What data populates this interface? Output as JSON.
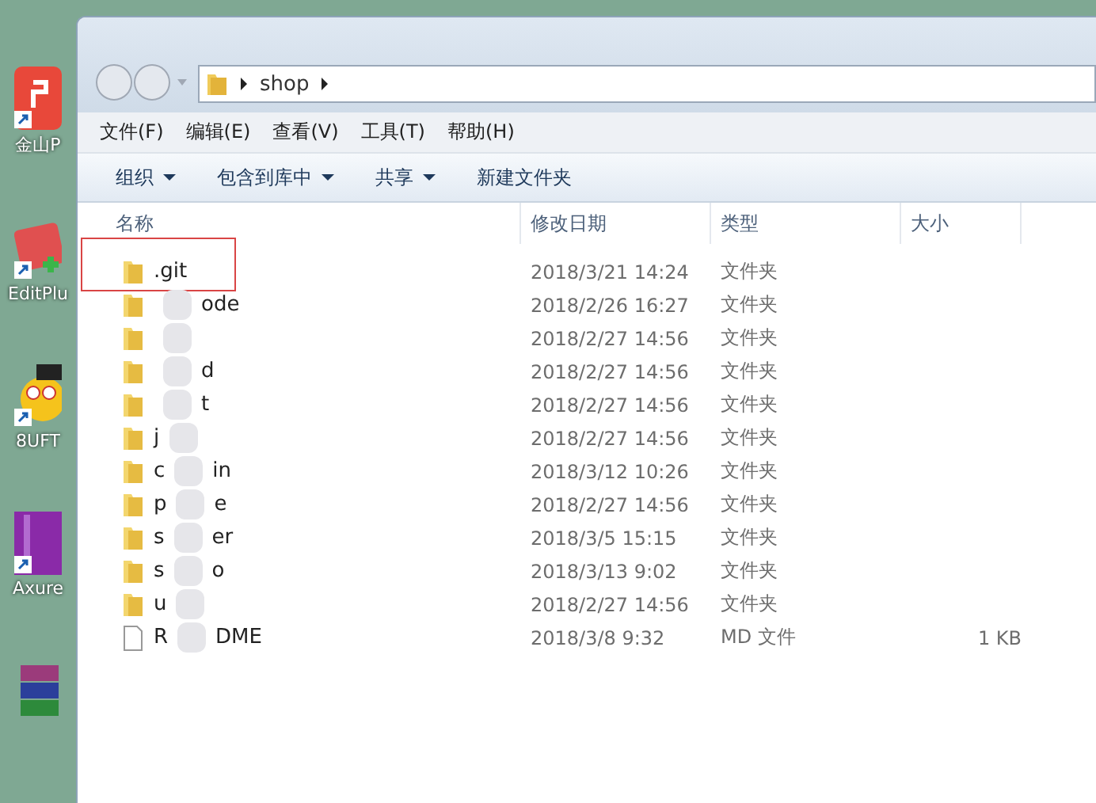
{
  "desktop_icons": [
    {
      "label": "金山P",
      "kind": "pdf"
    },
    {
      "label": "EditPlu",
      "kind": "edit"
    },
    {
      "label": "8UFT",
      "kind": "ftp"
    },
    {
      "label": "Axure",
      "kind": "axure"
    },
    {
      "kind": "archive"
    }
  ],
  "address": {
    "crumbs": [
      "shop"
    ]
  },
  "menu": [
    "文件(F)",
    "编辑(E)",
    "查看(V)",
    "工具(T)",
    "帮助(H)"
  ],
  "toolbar": [
    {
      "label": "组织",
      "dropdown": true
    },
    {
      "label": "包含到库中",
      "dropdown": true
    },
    {
      "label": "共享",
      "dropdown": true
    },
    {
      "label": "新建文件夹",
      "dropdown": false
    }
  ],
  "columns": [
    "名称",
    "修改日期",
    "类型",
    "大小"
  ],
  "rows": [
    {
      "kind": "folder",
      "name_start": ".git",
      "blurred": false,
      "highlighted": true,
      "modified": "2018/3/21 14:24",
      "type": "文件夹"
    },
    {
      "kind": "folder",
      "name_end": "ode",
      "blurred": true,
      "highlighted": false,
      "modified": "2018/2/26 16:27",
      "type": "文件夹"
    },
    {
      "kind": "folder",
      "blurred": true,
      "highlighted": false,
      "modified": "2018/2/27 14:56",
      "type": "文件夹"
    },
    {
      "kind": "folder",
      "name_end": "d",
      "blurred": true,
      "highlighted": false,
      "modified": "2018/2/27 14:56",
      "type": "文件夹"
    },
    {
      "kind": "folder",
      "name_end": "t",
      "blurred": true,
      "highlighted": false,
      "modified": "2018/2/27 14:56",
      "type": "文件夹"
    },
    {
      "kind": "folder",
      "name_start": "j",
      "blurred": true,
      "highlighted": false,
      "modified": "2018/2/27 14:56",
      "type": "文件夹"
    },
    {
      "kind": "folder",
      "name_start": "c",
      "name_end": "in",
      "blurred": true,
      "highlighted": false,
      "modified": "2018/3/12 10:26",
      "type": "文件夹"
    },
    {
      "kind": "folder",
      "name_start": "p",
      "name_end": "e",
      "blurred": true,
      "highlighted": false,
      "modified": "2018/2/27 14:56",
      "type": "文件夹"
    },
    {
      "kind": "folder",
      "name_start": "s",
      "name_end": "er",
      "blurred": true,
      "highlighted": false,
      "modified": "2018/3/5 15:15",
      "type": "文件夹"
    },
    {
      "kind": "folder",
      "name_start": "s",
      "name_end": "o",
      "blurred": true,
      "highlighted": false,
      "modified": "2018/3/13 9:02",
      "type": "文件夹"
    },
    {
      "kind": "folder",
      "name_start": "u",
      "blurred": true,
      "highlighted": false,
      "modified": "2018/2/27 14:56",
      "type": "文件夹"
    },
    {
      "kind": "file",
      "name_start": "R",
      "name_end": "DME",
      "blurred": true,
      "highlighted": false,
      "modified": "2018/3/8 9:32",
      "type": "MD 文件",
      "size": "1 KB"
    }
  ]
}
